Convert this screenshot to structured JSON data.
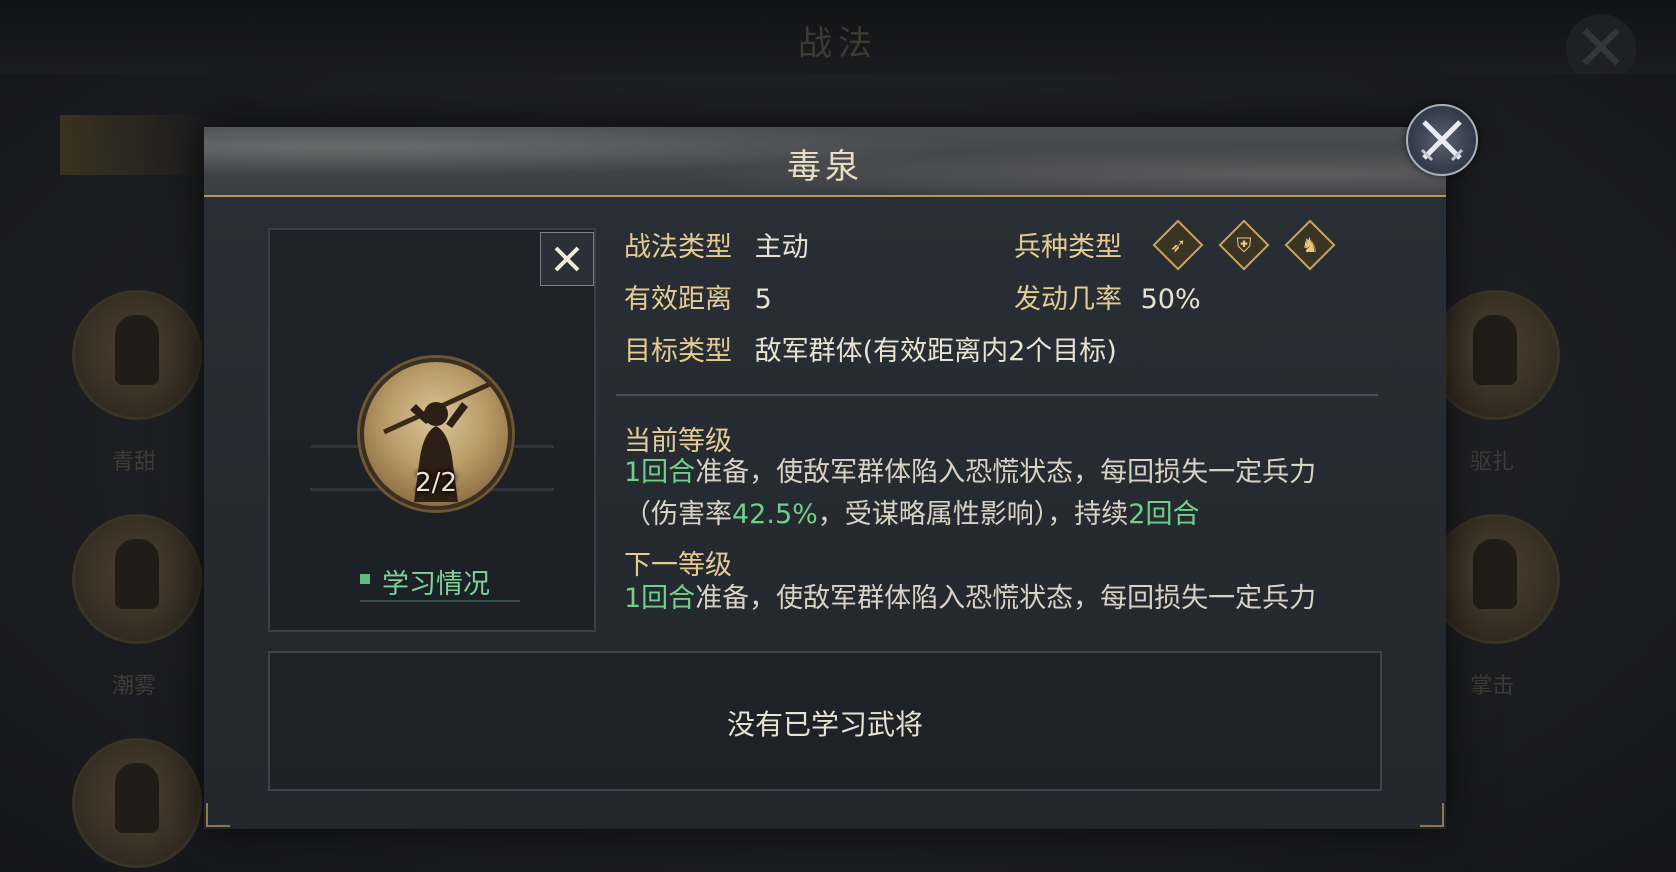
{
  "background": {
    "title": "战法",
    "left_names": [
      "青甜",
      "潮雾",
      ""
    ],
    "right_names": [
      "驱扎",
      "掌击"
    ]
  },
  "modal": {
    "title": "毒泉",
    "close_icon": "crossed-swords-close-icon"
  },
  "skill": {
    "count": "2/2",
    "learn_status_label": "学习情况",
    "close_label": "✕"
  },
  "info": {
    "type_label": "战法类型",
    "type_value": "主动",
    "troop_label": "兵种类型",
    "troop_icons": [
      "bow-icon",
      "shield-icon",
      "horse-icon"
    ],
    "range_label": "有效距离",
    "range_value": "5",
    "chance_label": "发动几率",
    "chance_value": "50%",
    "target_label": "目标类型",
    "target_value": "敌军群体(有效距离内2个目标)"
  },
  "levels": {
    "current_title": "当前等级",
    "current_line1_hl": "1回合",
    "current_line1_rest": "准备，使敌军群体陷入恐慌状态，每回损失一定兵力",
    "current_line2_a": "（伤害率",
    "current_line2_hl1": "42.5%",
    "current_line2_b": "，受谋略属性影响），持续",
    "current_line2_hl2": "2回合",
    "next_title": "下一等级",
    "next_line1_hl": "1回合",
    "next_line1_rest": "准备，使敌军群体陷入恐慌状态，每回损失一定兵力"
  },
  "generals": {
    "empty_text": "没有已学习武将"
  },
  "colors": {
    "gold": "#e2cc92",
    "highlight_green": "#6ed08b",
    "divider_gold": "#b49a55"
  }
}
